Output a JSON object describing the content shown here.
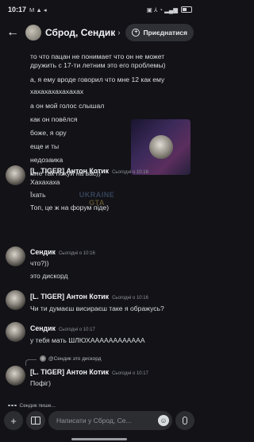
{
  "status_bar": {
    "time": "10:17",
    "left_icons": "M ▲ ◂",
    "right_icons": "▣ ⅄ ◔ ▂▄▆"
  },
  "header": {
    "back_icon": "arrow-left-icon",
    "channel_title": "Сброд, Сендик",
    "chevron": "›",
    "join_label": "Приєднатися"
  },
  "continuation_lines": [
    "то что пацан не понимает что он не может",
    "дружить с 17-ти летним это его проблемы)",
    "а, я ему вроде говорил что мне 12 как ему",
    "хахахахахахахах",
    "а он мой голос слышал",
    "как он повёлся",
    "боже, я ору",
    "еще и ты",
    "недозаика",
    "мне так похуй на вас))"
  ],
  "messages": [
    {
      "author": "[L. TIGER] Антон Котик",
      "timestamp": "Сьогодні о 10:16",
      "lines": [
        "Хахахаха",
        "Їхать",
        "Топ, це ж на форум піде)"
      ]
    },
    {
      "author": "Сендик",
      "timestamp": "Сьогодні о 10:16",
      "lines": [
        "что?))",
        "это дискорд"
      ]
    },
    {
      "author": "[L. TIGER] Антон Котик",
      "timestamp": "Сьогодні о 10:16",
      "lines": [
        "Чи ти думаєш висираєш таке я ображусь?"
      ]
    },
    {
      "author": "Сендик",
      "timestamp": "Сьогодні о 10:17",
      "lines": [
        "у тебя мать ШЛЮХАААААААААААА"
      ]
    },
    {
      "reply_to": "@Сендик это дискорд",
      "author": "[L. TIGER] Антон Котик",
      "timestamp": "Сьогодні о 10:17",
      "lines": [
        "Пофіг)"
      ]
    }
  ],
  "watermark": {
    "line1": "UKRAINE",
    "line2": "GTA"
  },
  "typing_indicator": "Сендик пише...",
  "composer": {
    "placeholder": "Написати у Сброд, Се...",
    "plus_icon": "+",
    "emoji_icon": "☺"
  }
}
